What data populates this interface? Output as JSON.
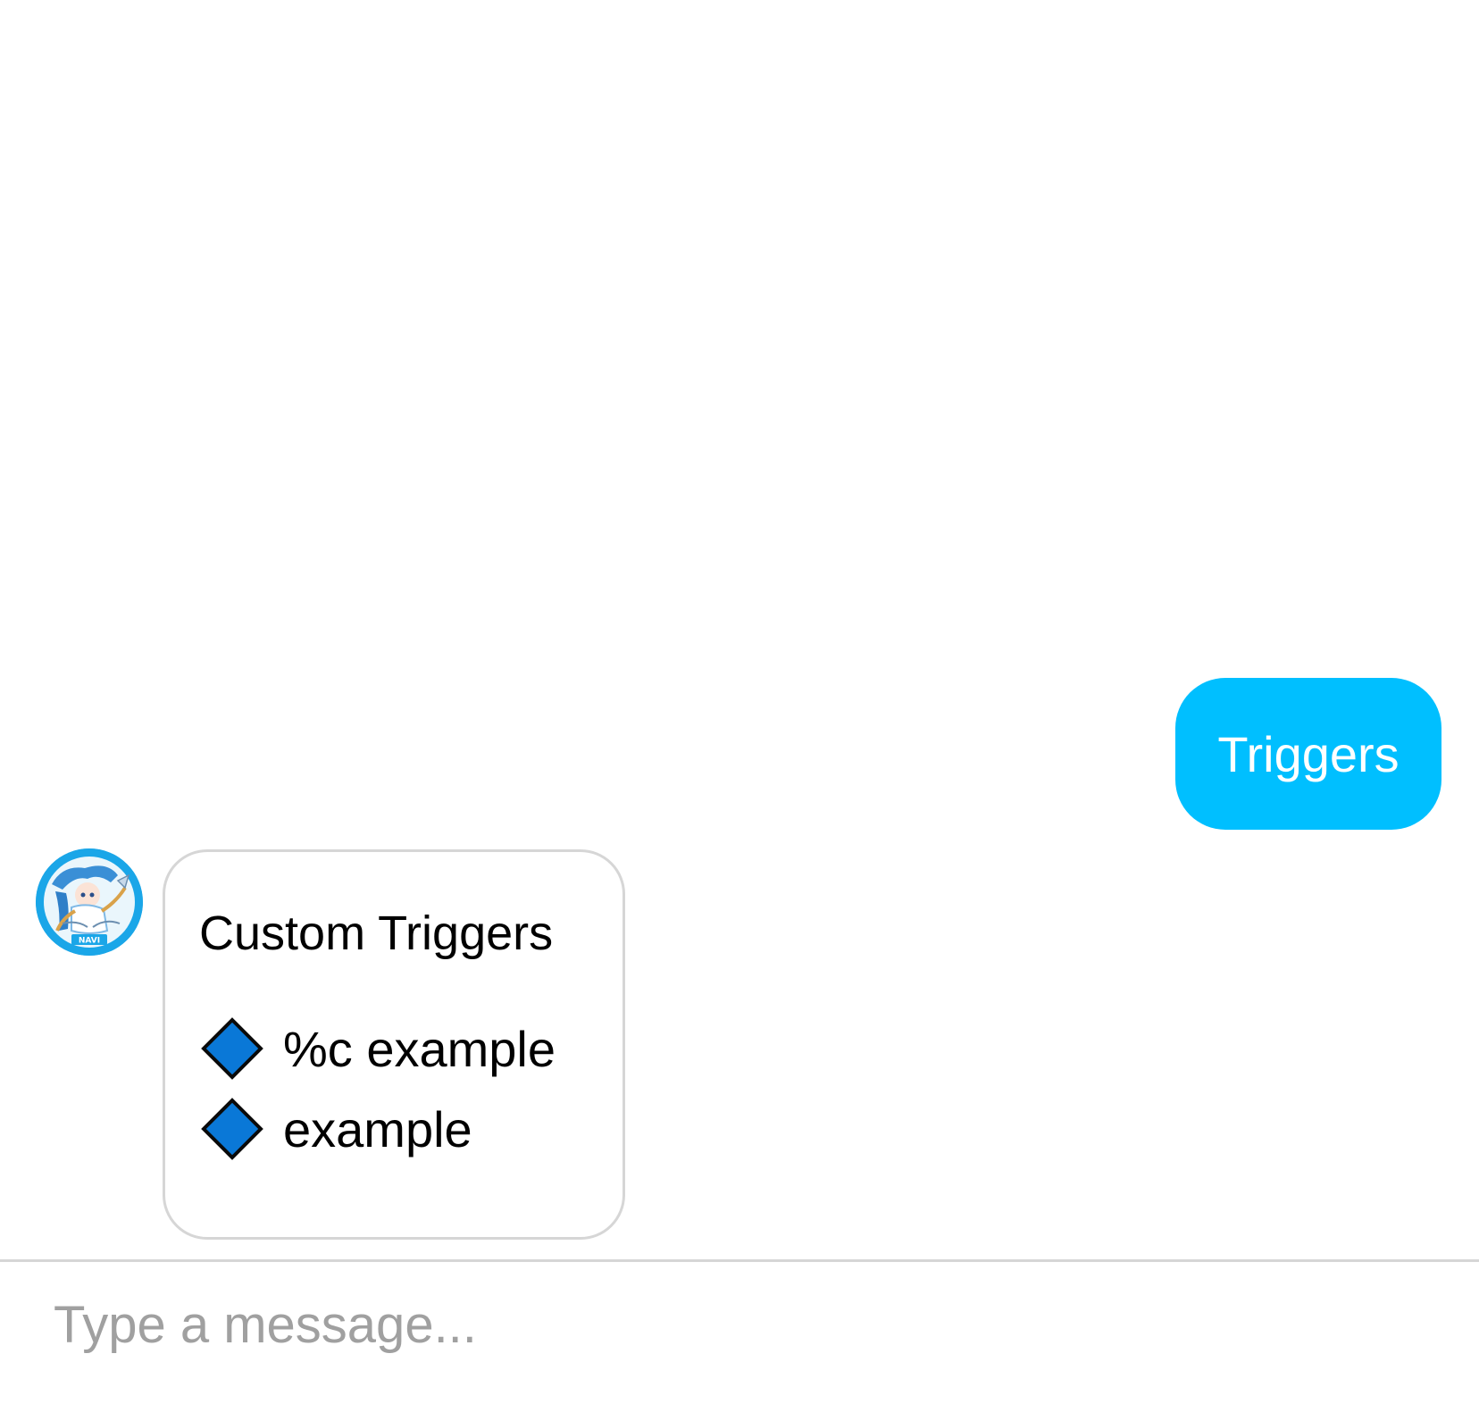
{
  "chat": {
    "user_message": "Triggers",
    "bot_message": {
      "avatar_label": "NAVI",
      "title": "Custom Triggers",
      "items": [
        {
          "icon": "blue-diamond-icon",
          "text": "%c example"
        },
        {
          "icon": "blue-diamond-icon",
          "text": "example"
        }
      ]
    }
  },
  "composer": {
    "placeholder": "Type a message...",
    "value": ""
  },
  "colors": {
    "user_bubble": "#00bfff",
    "diamond_fill": "#0a78d7",
    "bubble_border": "#d6d6d6",
    "placeholder": "#a0a0a0"
  }
}
